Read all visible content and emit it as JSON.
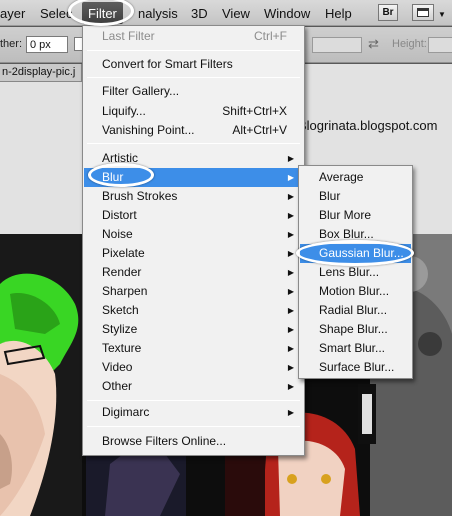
{
  "menubar": {
    "items": [
      "ayer",
      "Selec",
      "Filter",
      "nalysis",
      "3D",
      "View",
      "Window",
      "Help"
    ],
    "bridge_label": "Br"
  },
  "options": {
    "feather_label": "ther:",
    "feather_value": "0 px",
    "height_label": "Height:"
  },
  "document": {
    "tab_label": "n-2display-pic.j",
    "watermark": "Blogrinata.blogspot.com"
  },
  "filter_menu": {
    "items": [
      {
        "label": "Last Filter",
        "shortcut": "Ctrl+F"
      },
      {
        "label": "Convert for Smart Filters"
      },
      {
        "label": "Filter Gallery..."
      },
      {
        "label": "Liquify...",
        "shortcut": "Shift+Ctrl+X"
      },
      {
        "label": "Vanishing Point...",
        "shortcut": "Alt+Ctrl+V"
      },
      {
        "label": "Artistic"
      },
      {
        "label": "Blur"
      },
      {
        "label": "Brush Strokes"
      },
      {
        "label": "Distort"
      },
      {
        "label": "Noise"
      },
      {
        "label": "Pixelate"
      },
      {
        "label": "Render"
      },
      {
        "label": "Sharpen"
      },
      {
        "label": "Sketch"
      },
      {
        "label": "Stylize"
      },
      {
        "label": "Texture"
      },
      {
        "label": "Video"
      },
      {
        "label": "Other"
      },
      {
        "label": "Digimarc"
      },
      {
        "label": "Browse Filters Online..."
      }
    ]
  },
  "blur_menu": {
    "items": [
      {
        "label": "Average"
      },
      {
        "label": "Blur"
      },
      {
        "label": "Blur More"
      },
      {
        "label": "Box Blur..."
      },
      {
        "label": "Gaussian Blur..."
      },
      {
        "label": "Lens Blur..."
      },
      {
        "label": "Motion Blur..."
      },
      {
        "label": "Radial Blur..."
      },
      {
        "label": "Shape Blur..."
      },
      {
        "label": "Smart Blur..."
      },
      {
        "label": "Surface Blur..."
      }
    ]
  },
  "colors": {
    "highlight": "#3d8ee8",
    "menu_bg": "#f1f1f1",
    "annotation": "#ffffff"
  },
  "icons": {
    "submenu_arrow": "triangle-right-icon",
    "dropdown_arrow": "triangle-down-icon",
    "swap": "swap-arrows-icon"
  }
}
